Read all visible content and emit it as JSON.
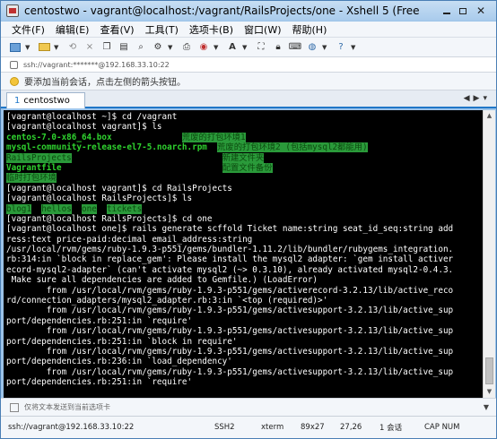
{
  "window": {
    "title": "centostwo - vagrant@localhost:/vagrant/RailsProjects/one - Xshell 5 (Free..."
  },
  "menu": [
    "文件(F)",
    "编辑(E)",
    "查看(V)",
    "工具(T)",
    "选项卡(B)",
    "窗口(W)",
    "帮助(H)"
  ],
  "address": "ssh://vagrant:*******@192.168.33.10:22",
  "hint": "要添加当前会话，点击左侧的箭头按钮。",
  "tab": {
    "number": "1",
    "label": "centostwo"
  },
  "terminal": {
    "lines": [
      [
        {
          "t": "[vagrant@localhost ~]$ cd /vagrant"
        }
      ],
      [
        {
          "t": "[vagrant@localhost vagrant]$ ls"
        }
      ],
      [
        {
          "t": "centos-7.0-x86_64.box",
          "c": "g"
        },
        {
          "t": "              "
        },
        {
          "t": "荒废的打包环境1",
          "c": "gb"
        }
      ],
      [
        {
          "t": "mysql-community-release-el7-5.noarch.rpm",
          "c": "g"
        },
        {
          "t": "  "
        },
        {
          "t": "荒废的打包环境2 (包括mysql2都能用)",
          "c": "gb"
        }
      ],
      [
        {
          "t": "RailsProjects",
          "c": "gb"
        },
        {
          "t": "                              "
        },
        {
          "t": "新建文件夹",
          "c": "gb"
        }
      ],
      [
        {
          "t": "Vagrantfile",
          "c": "g"
        },
        {
          "t": "                                "
        },
        {
          "t": "配置文件备份",
          "c": "gb"
        }
      ],
      [
        {
          "t": "临时打包环境",
          "c": "gb"
        }
      ],
      [
        {
          "t": "[vagrant@localhost vagrant]$ cd RailsProjects"
        }
      ],
      [
        {
          "t": "[vagrant@localhost RailsProjects]$ ls"
        }
      ],
      [
        {
          "t": "blog1",
          "c": "gb"
        },
        {
          "t": "  "
        },
        {
          "t": "hellos",
          "c": "gb"
        },
        {
          "t": "  "
        },
        {
          "t": "one",
          "c": "gb"
        },
        {
          "t": "  "
        },
        {
          "t": "tickets",
          "c": "gb"
        }
      ],
      [
        {
          "t": "[vagrant@localhost RailsProjects]$ cd one"
        }
      ],
      [
        {
          "t": "[vagrant@localhost one]$ rails generate scffold Ticket name:string seat_id_seq:string add"
        }
      ],
      [
        {
          "t": "ress:text price-paid:decimal email_address:string"
        }
      ],
      [
        {
          "t": "/usr/local/rvm/gems/ruby-1.9.3-p551/gems/bundler-1.11.2/lib/bundler/rubygems_integration."
        }
      ],
      [
        {
          "t": "rb:314:in `block in replace_gem': Please install the mysql2 adapter: `gem install activer"
        }
      ],
      [
        {
          "t": "ecord-mysql2-adapter` (can't activate mysql2 (~> 0.3.10), already activated mysql2-0.4.3."
        }
      ],
      [
        {
          "t": " Make sure all dependencies are added to Gemfile.) (LoadError)"
        }
      ],
      [
        {
          "t": "        from /usr/local/rvm/gems/ruby-1.9.3-p551/gems/activerecord-3.2.13/lib/active_reco"
        }
      ],
      [
        {
          "t": "rd/connection_adapters/mysql2_adapter.rb:3:in `<top (required)>'"
        }
      ],
      [
        {
          "t": "        from /usr/local/rvm/gems/ruby-1.9.3-p551/gems/activesupport-3.2.13/lib/active_sup"
        }
      ],
      [
        {
          "t": "port/dependencies.rb:251:in `require'"
        }
      ],
      [
        {
          "t": "        from /usr/local/rvm/gems/ruby-1.9.3-p551/gems/activesupport-3.2.13/lib/active_sup"
        }
      ],
      [
        {
          "t": "port/dependencies.rb:251:in `block in require'"
        }
      ],
      [
        {
          "t": "        from /usr/local/rvm/gems/ruby-1.9.3-p551/gems/activesupport-3.2.13/lib/active_sup"
        }
      ],
      [
        {
          "t": "port/dependencies.rb:236:in `load_dependency'"
        }
      ],
      [
        {
          "t": "        from /usr/local/rvm/gems/ruby-1.9.3-p551/gems/activesupport-3.2.13/lib/active_sup"
        }
      ],
      [
        {
          "t": "port/dependencies.rb:251:in `require'"
        }
      ]
    ]
  },
  "sendbar": {
    "placeholder": "仅将文本发送到当前选项卡"
  },
  "status": {
    "connection": "ssh://vagrant@192.168.33.10:22",
    "protocol": "SSH2",
    "term": "xterm",
    "size": "89x27",
    "cursor": "27,26",
    "sessions": "1 会话",
    "caps": "CAP NUM"
  },
  "colors": {
    "accent": "#1f77c8",
    "terminal_bg": "#000000",
    "ls_green": "#2fd32f",
    "dir_bg": "#2a9a3a"
  }
}
